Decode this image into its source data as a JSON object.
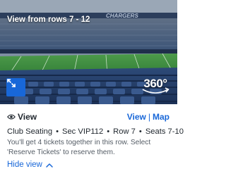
{
  "seat_view": {
    "caption": "View from rows 7 - 12",
    "stadium_banner": "CHARGERS",
    "expand_icon": "expand-arrows-icon",
    "badge_label": "360°"
  },
  "toggle": {
    "label": "View",
    "icon": "eye-icon",
    "view_link": "View",
    "separator": "|",
    "map_link": "Map"
  },
  "seat_info": {
    "section_type": "Club Seating",
    "section": "Sec VIP112",
    "row": "Row 7",
    "seats": "Seats 7-10",
    "separator": "•"
  },
  "note": "You'll get 4 tickets together in this row. Select 'Reserve Tickets' to reserve them.",
  "hide_view": {
    "label": "Hide view",
    "icon": "chevron-up-icon"
  },
  "colors": {
    "accent": "#1867d8",
    "field": "#3b8a3e",
    "seats": "#27446f",
    "sky": "#7f8fa3"
  }
}
